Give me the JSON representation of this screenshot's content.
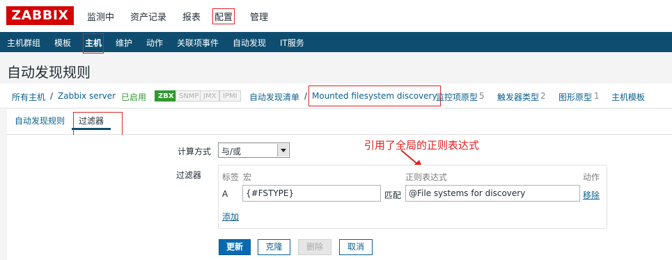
{
  "logo": "ZABBIX",
  "top_nav": [
    "监测中",
    "资产记录",
    "报表",
    "配置",
    "管理"
  ],
  "sub_nav": [
    "主机群组",
    "模板",
    "主机",
    "维护",
    "动作",
    "关联项事件",
    "自动发现",
    "IT服务"
  ],
  "page_title": "自动发现规则",
  "breadcrumb": {
    "all_hosts": "所有主机",
    "sep": "/",
    "host": "Zabbix server",
    "status": "已启用",
    "badges": [
      "ZBX",
      "SNMP",
      "JMX",
      "IPMI"
    ],
    "discovery_list": "自动发现清单",
    "current_rule": "Mounted filesystem discovery",
    "item_prototypes": "监控项原型",
    "item_prototypes_count": "5",
    "trigger_prototypes": "触发器类型",
    "trigger_prototypes_count": "2",
    "graph_prototypes": "图形原型",
    "graph_prototypes_count": "1",
    "host_prototypes": "主机模板"
  },
  "tabs": [
    "自动发现规则",
    "过滤器"
  ],
  "form": {
    "calc_label": "计算方式",
    "calc_value": "与/或",
    "filter_label": "过滤器",
    "annotation": "引用了全局的正则表达式",
    "headers": {
      "label": "标签",
      "macro": "宏",
      "regex": "正则表达式",
      "action": "动作"
    },
    "row": {
      "label": "A",
      "macro": "{#FSTYPE}",
      "op": "匹配",
      "regex": "@File systems for discovery",
      "remove": "移除"
    },
    "add": "添加"
  },
  "buttons": {
    "update": "更新",
    "clone": "克隆",
    "delete": "删除",
    "cancel": "取消"
  },
  "colors": {
    "brand_red": "#d40000",
    "nav_blue": "#0e4d6f",
    "link_blue": "#0a5f8f",
    "enabled_green": "#2f9a2f",
    "annotation_red": "#e02020"
  }
}
